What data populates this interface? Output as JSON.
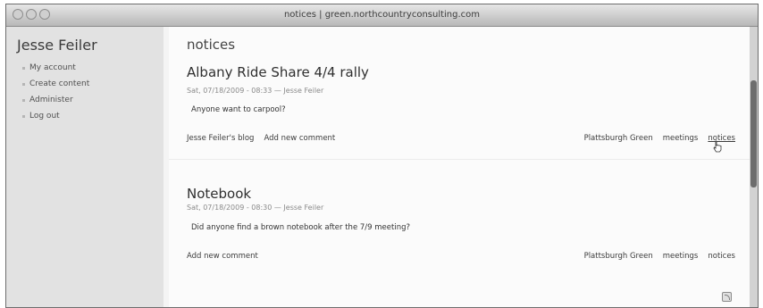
{
  "window": {
    "title": "notices | green.northcountryconsulting.com"
  },
  "sidebar": {
    "user_name": "Jesse Feiler",
    "menu": [
      "My account",
      "Create content",
      "Administer",
      "Log out"
    ]
  },
  "page": {
    "title": "notices"
  },
  "posts": [
    {
      "title": "Albany Ride Share 4/4 rally",
      "submitted": "Sat, 07/18/2009 - 08:33 — Jesse Feiler",
      "body": "Anyone want to carpool?",
      "links_left": [
        "Jesse Feiler's blog",
        "Add new comment"
      ],
      "tags": [
        "Plattsburgh Green",
        "meetings",
        "notices"
      ]
    },
    {
      "title": "Notebook",
      "submitted": "Sat, 07/18/2009 - 08:30 — Jesse Feiler",
      "body": "Did anyone find a brown notebook after the 7/9 meeting?",
      "links_left": [
        "Add new comment"
      ],
      "tags": [
        "Plattsburgh Green",
        "meetings",
        "notices"
      ]
    }
  ]
}
